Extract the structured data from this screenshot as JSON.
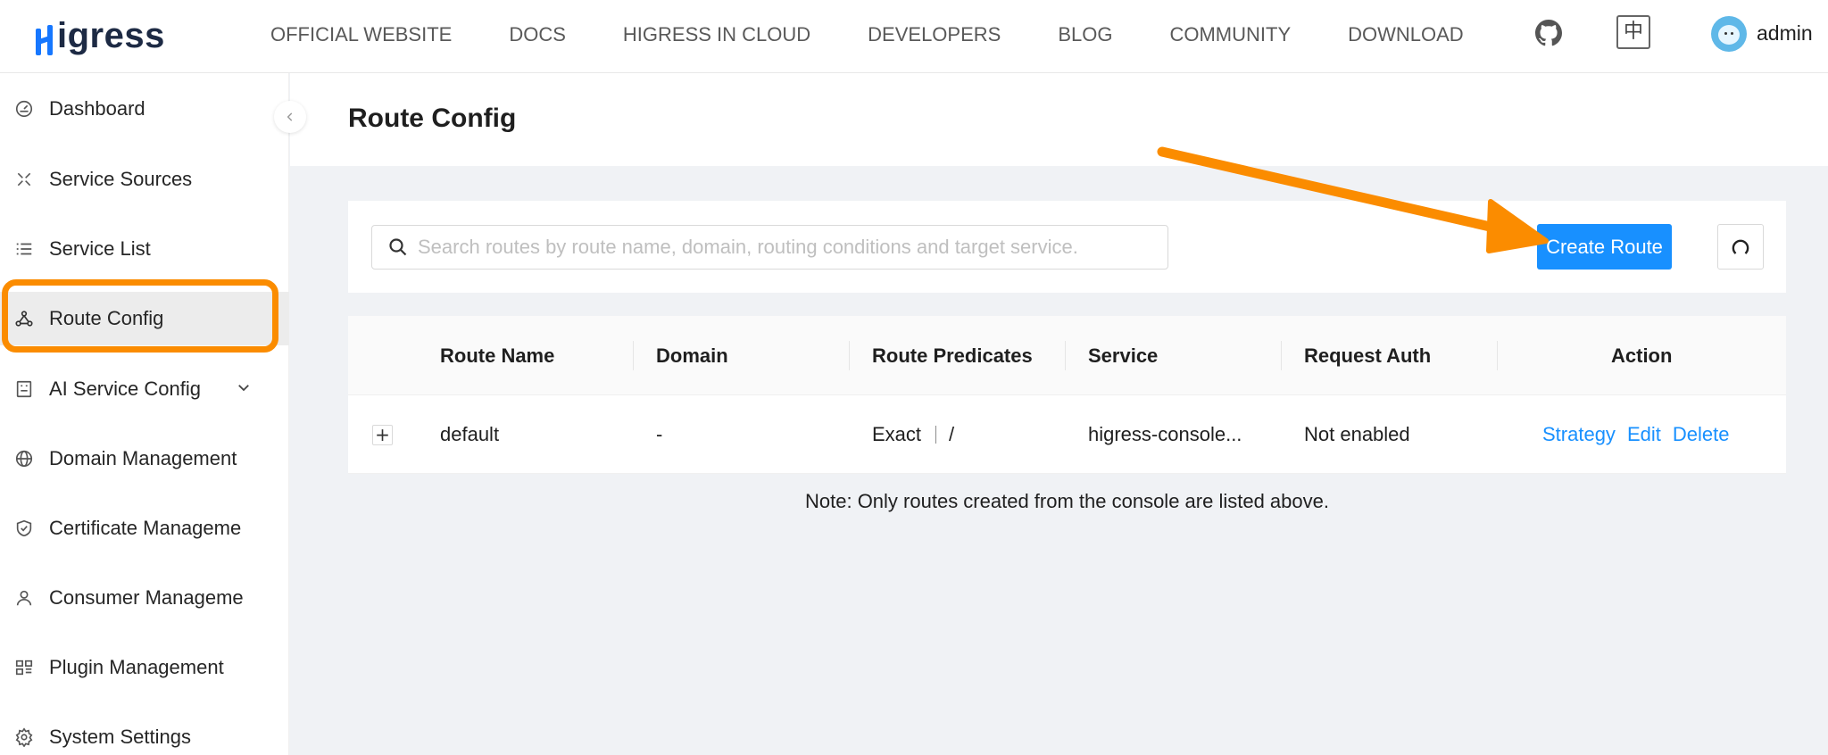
{
  "brand": {
    "name": "igress"
  },
  "nav": {
    "items": [
      "OFFICIAL WEBSITE",
      "DOCS",
      "HIGRESS IN CLOUD",
      "DEVELOPERS",
      "BLOG",
      "COMMUNITY",
      "DOWNLOAD"
    ],
    "lang_label": "中",
    "username": "admin"
  },
  "sidebar": {
    "items": [
      {
        "label": "Dashboard",
        "icon": "dashboard-icon"
      },
      {
        "label": "Service Sources",
        "icon": "service-sources-icon"
      },
      {
        "label": "Service List",
        "icon": "list-icon"
      },
      {
        "label": "Route Config",
        "icon": "route-icon",
        "active": true
      },
      {
        "label": "AI Service Config",
        "icon": "ai-icon"
      },
      {
        "label": "Domain Management",
        "icon": "globe-icon"
      },
      {
        "label": "Certificate Manageme",
        "icon": "shield-icon"
      },
      {
        "label": "Consumer Manageme",
        "icon": "user-icon"
      },
      {
        "label": "Plugin Management",
        "icon": "plugin-icon"
      },
      {
        "label": "System Settings",
        "icon": "gear-icon"
      }
    ]
  },
  "page": {
    "title": "Route Config"
  },
  "search": {
    "placeholder": "Search routes by route name, domain, routing conditions and target service.",
    "value": ""
  },
  "toolbar": {
    "create_label": "Create Route"
  },
  "table": {
    "columns": [
      "Route Name",
      "Domain",
      "Route Predicates",
      "Service",
      "Request Auth",
      "Action"
    ],
    "rows": [
      {
        "route_name": "default",
        "domain": "-",
        "predicate_type": "Exact",
        "predicate_path": "/",
        "service": "higress-console...",
        "request_auth": "Not enabled",
        "actions": [
          "Strategy",
          "Edit",
          "Delete"
        ]
      }
    ]
  },
  "note": "Note: Only routes created from the console are listed above.",
  "colors": {
    "primary": "#1890ff",
    "annotation": "#fb8c00",
    "brand": "#1677ff"
  }
}
